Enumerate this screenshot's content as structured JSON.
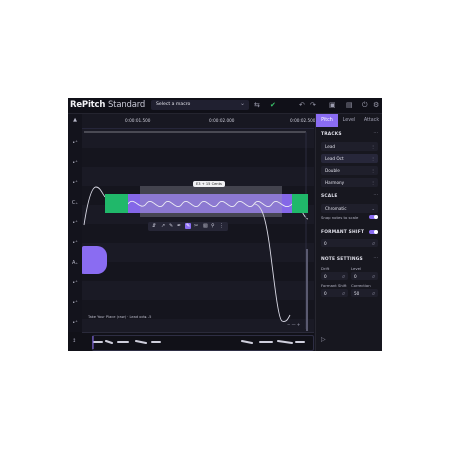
{
  "app": {
    "brand_name": "RePitch",
    "brand_edition": "Standard",
    "macro_placeholder": "Select a macro"
  },
  "ruler": {
    "times": [
      "0:00:01.500",
      "0:00:02.000",
      "0:00:02.500"
    ]
  },
  "editor": {
    "pitch_label": "E3 + 15 Cents",
    "track_caption": "Take Your Place (raw) · Lead oct▸ -5",
    "zoom_label": "− — +"
  },
  "panel": {
    "tabs": [
      "Pitch",
      "Level",
      "Attack"
    ],
    "active_tab": "Pitch",
    "tracks_title": "TRACKS",
    "tracks": [
      "Lead",
      "Lead Oct",
      "Double",
      "Harmony"
    ],
    "scale_title": "SCALE",
    "scale_value": "Chromatic",
    "snap_label": "Snap notes to scale",
    "formant_title": "FORMANT SHIFT",
    "formant_value": "0",
    "note_title": "NOTE SETTINGS",
    "drift_label": "Drift",
    "drift_value": "0",
    "level_label": "Level",
    "level_value": "0",
    "formant_shift_label": "Formant Shift",
    "formant_shift_value": "0",
    "correction_label": "Correction",
    "correction_value": "50"
  },
  "colors": {
    "accent": "#8a6cf2",
    "green": "#20b86a",
    "bg": "#15151f"
  }
}
